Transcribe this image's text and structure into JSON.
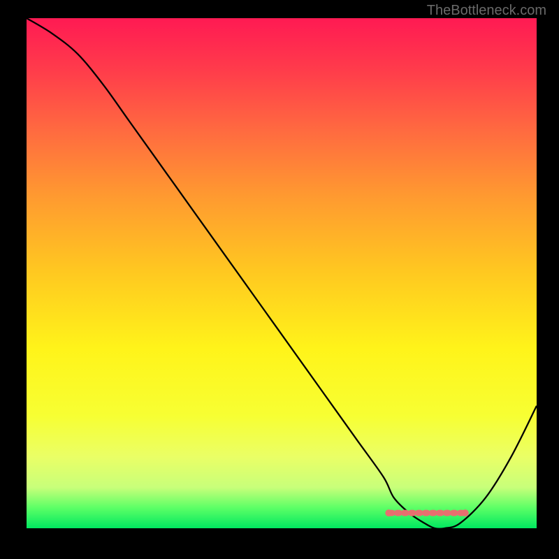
{
  "attribution": "TheBottleneck.com",
  "chart_data": {
    "type": "line",
    "title": "",
    "xlabel": "",
    "ylabel": "",
    "xlim": [
      0,
      100
    ],
    "ylim": [
      0,
      100
    ],
    "series": [
      {
        "name": "bottleneck-curve",
        "x": [
          0,
          5,
          10,
          15,
          20,
          25,
          30,
          35,
          40,
          45,
          50,
          55,
          60,
          65,
          70,
          72,
          75,
          78,
          80,
          82,
          85,
          90,
          95,
          100
        ],
        "y": [
          100,
          97,
          93,
          87,
          80,
          73,
          66,
          59,
          52,
          45,
          38,
          31,
          24,
          17,
          10,
          6,
          3,
          1,
          0,
          0,
          1,
          6,
          14,
          24
        ]
      }
    ],
    "optimal_zone": {
      "x_start": 71,
      "x_end": 86,
      "marker_y": 3
    },
    "gradient_stops": [
      {
        "pos": 0,
        "color": "#ff1a53"
      },
      {
        "pos": 10,
        "color": "#ff3b4b"
      },
      {
        "pos": 22,
        "color": "#ff6a40"
      },
      {
        "pos": 35,
        "color": "#ff9a30"
      },
      {
        "pos": 50,
        "color": "#ffc920"
      },
      {
        "pos": 65,
        "color": "#fff41a"
      },
      {
        "pos": 78,
        "color": "#f7ff33"
      },
      {
        "pos": 86,
        "color": "#eaff66"
      },
      {
        "pos": 92,
        "color": "#c8ff7a"
      },
      {
        "pos": 96,
        "color": "#5cff66"
      },
      {
        "pos": 100,
        "color": "#00e860"
      }
    ],
    "curve_color": "#000000",
    "optimal_marker_color": "#e76f6f"
  }
}
